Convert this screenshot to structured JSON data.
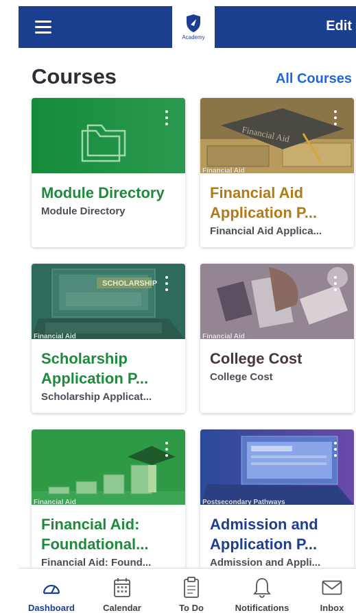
{
  "header": {
    "logo_text": "Academy",
    "edit_label": "Edit"
  },
  "courses_section": {
    "title": "Courses",
    "all_courses_label": "All Courses"
  },
  "courses": [
    {
      "title": "Module Directory",
      "subtitle": "Module Directory",
      "tag": "",
      "title_color": "#1f8a3c"
    },
    {
      "title": "Financial Aid Application P...",
      "subtitle": "Financial Aid Applica...",
      "tag": "Financial Aid",
      "title_color": "#b07a17"
    },
    {
      "title": "Scholarship Application P...",
      "subtitle": "Scholarship Applicat...",
      "tag": "Financial Aid",
      "title_color": "#1f8a3c"
    },
    {
      "title": "College Cost",
      "subtitle": "College Cost",
      "tag": "Financial Aid",
      "title_color": "#4a3540"
    },
    {
      "title": "Financial Aid: Foundational...",
      "subtitle": "Financial Aid: Found...",
      "tag": "Financial Aid",
      "title_color": "#1f8a3c"
    },
    {
      "title": "Admission and Application P...",
      "subtitle": "Admission and Appli...",
      "tag": "Postsecondary Pathways",
      "title_color": "#1e3f8f"
    }
  ],
  "bottom_nav": [
    {
      "label": "Dashboard",
      "icon": "dashboard-gauge-icon",
      "active": true
    },
    {
      "label": "Calendar",
      "icon": "calendar-icon",
      "active": false
    },
    {
      "label": "To Do",
      "icon": "clipboard-icon",
      "active": false
    },
    {
      "label": "Notifications",
      "icon": "bell-icon",
      "active": false
    },
    {
      "label": "Inbox",
      "icon": "envelope-icon",
      "active": false
    }
  ],
  "colors": {
    "header_bg": "#1b3f8f",
    "link_blue": "#1f69d6",
    "green": "#1f8a3c",
    "gold": "#b07a17",
    "navy": "#1e3f8f"
  }
}
